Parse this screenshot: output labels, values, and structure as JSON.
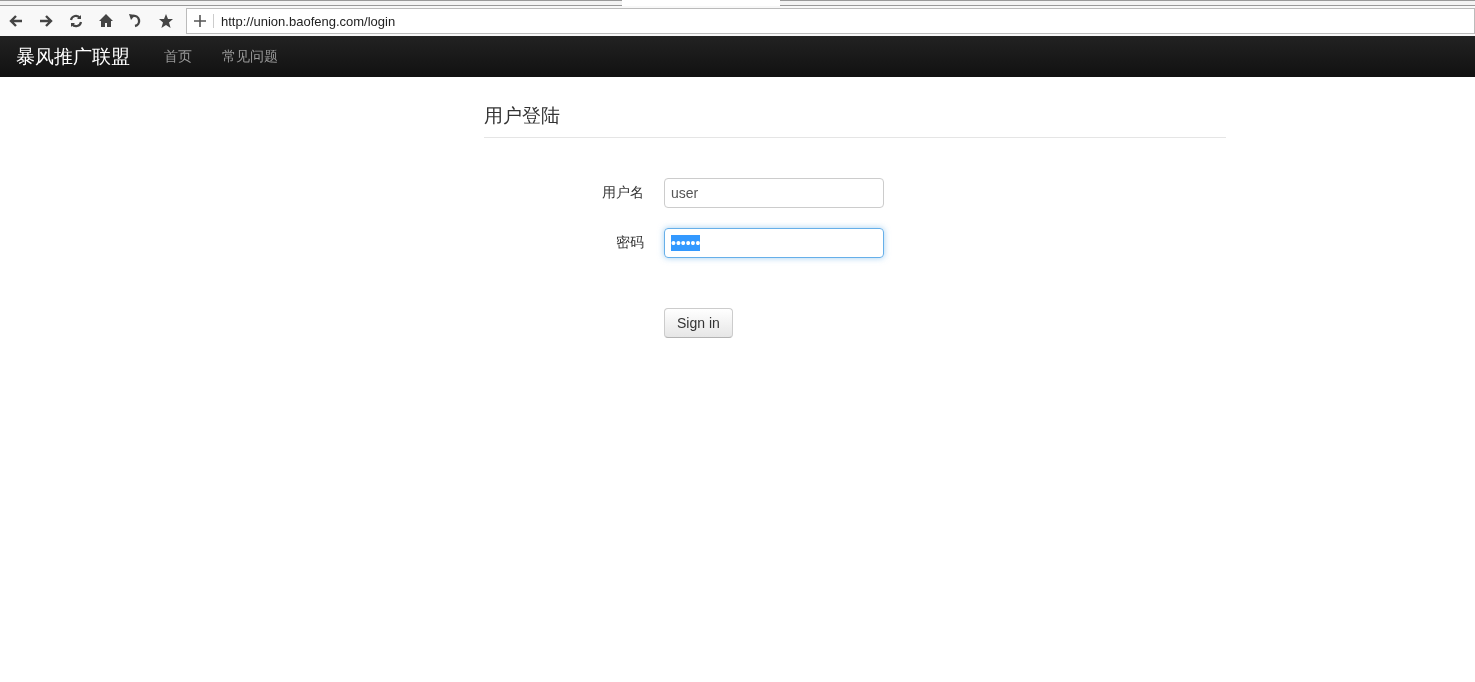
{
  "browser": {
    "url": "http://union.baofeng.com/login"
  },
  "navbar": {
    "brand": "暴风推广联盟",
    "items": [
      {
        "label": "首页",
        "selected": false
      },
      {
        "label": "常见问题",
        "selected": false
      }
    ]
  },
  "page_title": "用户登陆",
  "fields": [
    {
      "label": "用户名",
      "value": "user",
      "focused": false,
      "text_selected": false
    },
    {
      "label": "密码",
      "value": "••••••",
      "focused": true,
      "text_selected": true
    }
  ],
  "submit_button": "Sign in"
}
